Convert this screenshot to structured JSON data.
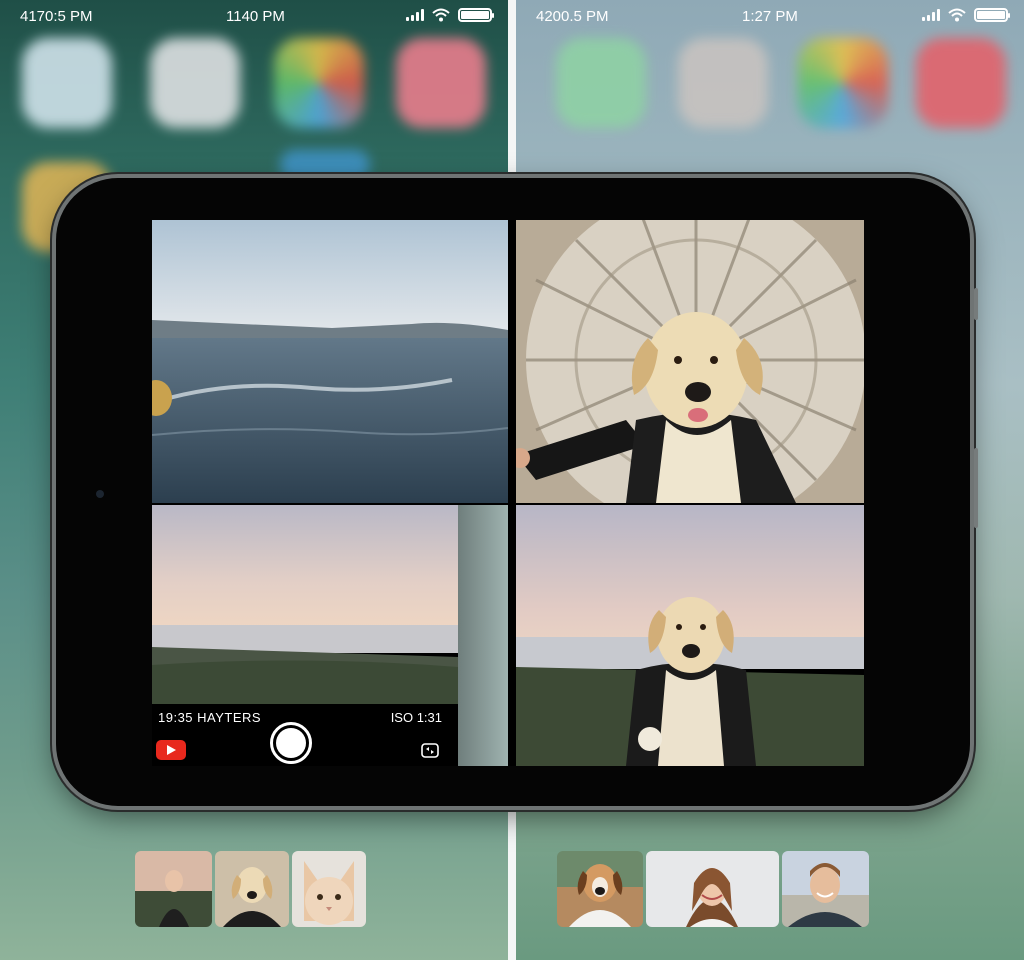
{
  "left_screen": {
    "status": {
      "time_left": "4170:5 PM",
      "time_center": "1140 PM"
    }
  },
  "right_screen": {
    "status": {
      "time_left": "4200.5 PM",
      "time_center": "1:27 PM"
    }
  },
  "camera_overlay": {
    "meta_left": "19:35 HAYTERS",
    "meta_right": "ISO 1:31"
  },
  "tiles": [
    {
      "name": "tile-sea",
      "subject": "sea-waves"
    },
    {
      "name": "tile-dog-selfie-mandala",
      "subject": "dog-selfie"
    },
    {
      "name": "tile-sunset-shore",
      "subject": "sunset"
    },
    {
      "name": "tile-dog-selfie-beach",
      "subject": "dog-selfie-beach"
    }
  ],
  "thumbnails_left": [
    "woman-sunset",
    "dog-black-jacket",
    "cat-face"
  ],
  "thumbnails_right": [
    "dog-hoodie",
    "woman-smiling",
    "man-smiling"
  ],
  "colors": {
    "youtube_red": "#e8281d",
    "divider": "#f4f6f6"
  }
}
